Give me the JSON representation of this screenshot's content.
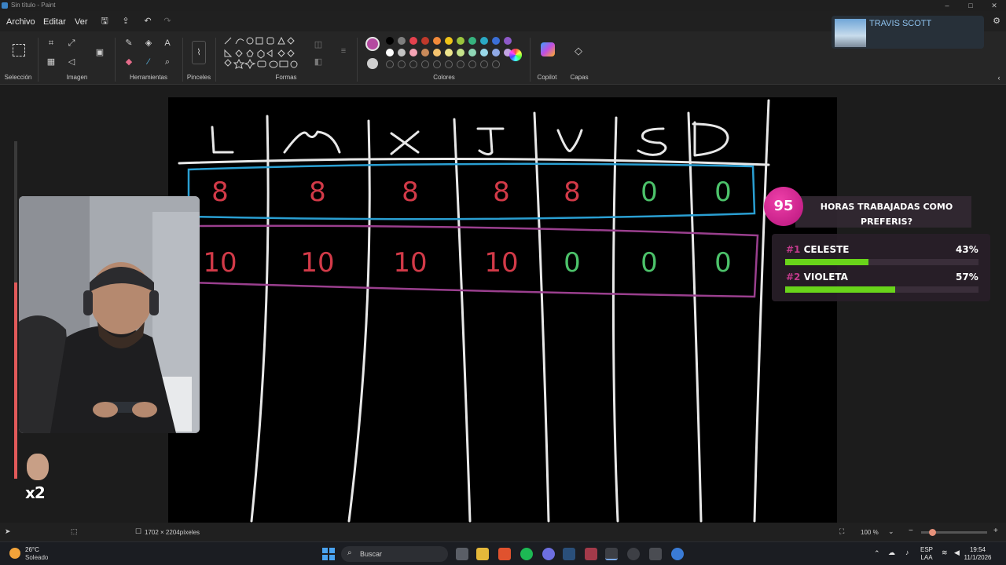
{
  "window": {
    "title": "Sin título - Paint"
  },
  "menu": {
    "file": "Archivo",
    "edit": "Editar",
    "view": "Ver"
  },
  "ribbon": {
    "groups": [
      "Selección",
      "Imagen",
      "Herramientas",
      "Pinceles",
      "Formas",
      "Colores",
      "Copilot",
      "Capas"
    ]
  },
  "colors": {
    "active": "#b44aa0",
    "palette_row1": [
      "#000000",
      "#7f7f7f",
      "#e5414e",
      "#c0392b",
      "#f28a3a",
      "#f0c419",
      "#9bc53d",
      "#36b37e",
      "#2aa9c4",
      "#3b6fd6",
      "#8e59c8"
    ],
    "palette_row2": [
      "#ffffff",
      "#c3c3c3",
      "#f4a3b4",
      "#c98a5a",
      "#f5c36e",
      "#eee58d",
      "#c5e38a",
      "#8fd6b5",
      "#99d8e8",
      "#8fa9e5",
      "#c2a4e3"
    ]
  },
  "canvas_drawing": {
    "days": [
      "L",
      "M",
      "X",
      "J",
      "V",
      "S",
      "D"
    ],
    "row_celeste": [
      "8",
      "8",
      "8",
      "8",
      "8",
      "0",
      "0"
    ],
    "row_violeta": [
      "10",
      "10",
      "10",
      "10",
      "0",
      "0",
      "0"
    ]
  },
  "music": {
    "artist": "TRAVIS SCOTT"
  },
  "poll": {
    "count": "95",
    "question": "HORAS TRABAJADAS COMO PREFERIS?",
    "options": [
      {
        "num": "#1",
        "label": "CELESTE",
        "pct": "43%",
        "fraction": 0.43
      },
      {
        "num": "#2",
        "label": "VIOLETA",
        "pct": "57%",
        "fraction": 0.57
      }
    ]
  },
  "subs": {
    "multiplier": "x2"
  },
  "status": {
    "dimensions": "1702 × 2204píxeles",
    "zoom": "100 %"
  },
  "taskbar": {
    "temp": "26°C",
    "condition": "Soleado",
    "search": "Buscar",
    "lang": "ESP",
    "region": "LAA",
    "time": "19:54",
    "date": "11/1/2026"
  }
}
